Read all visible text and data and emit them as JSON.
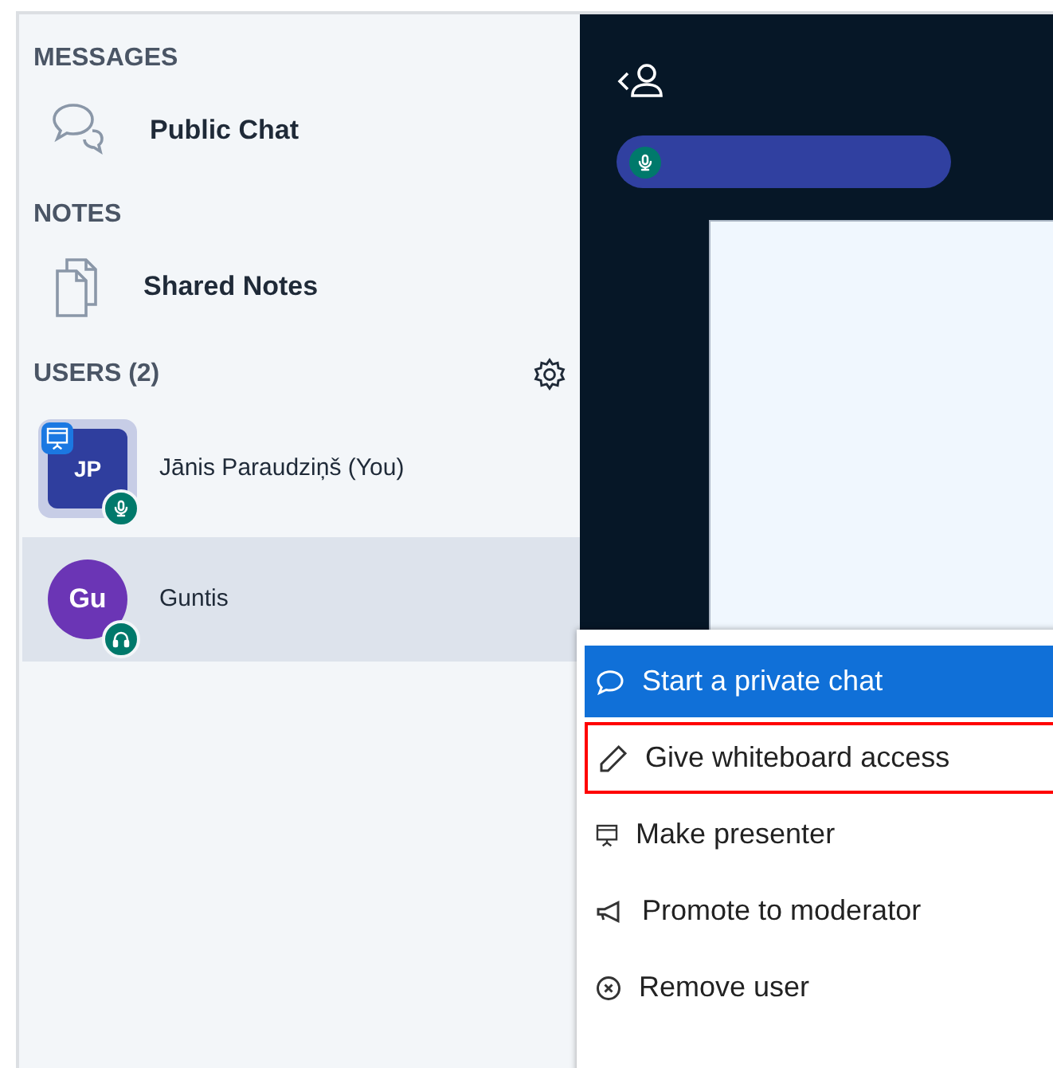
{
  "sidebar": {
    "messages": {
      "heading": "MESSAGES",
      "items": [
        {
          "label": "Public Chat",
          "kind": "chat"
        }
      ]
    },
    "notes": {
      "heading": "NOTES",
      "items": [
        {
          "label": "Shared Notes",
          "kind": "notes"
        }
      ]
    },
    "users": {
      "heading": "USERS (2)",
      "items": [
        {
          "initials": "JP",
          "name": "Jānis Paraudziņš (You)",
          "kind": "moderator",
          "color": "#2f3e9e",
          "presenter": true,
          "audio_status": {
            "kind": "mic"
          },
          "selected": false
        },
        {
          "initials": "Gu",
          "name": "Guntis",
          "kind": "viewer",
          "color": "#6b35b5",
          "presenter": false,
          "audio_status": {
            "kind": "headphones"
          },
          "selected": true
        }
      ]
    }
  },
  "context_menu": {
    "items": [
      {
        "label": "Start a private chat",
        "kind": "chat",
        "selected": true,
        "outlined": false
      },
      {
        "label": "Give whiteboard access",
        "kind": "pencil",
        "selected": false,
        "outlined": true
      },
      {
        "label": "Make presenter",
        "kind": "presenter",
        "selected": false,
        "outlined": false
      },
      {
        "label": "Promote to moderator",
        "kind": "megaphone",
        "selected": false,
        "outlined": false
      },
      {
        "label": "Remove user",
        "kind": "remove",
        "selected": false,
        "outlined": false
      }
    ]
  }
}
